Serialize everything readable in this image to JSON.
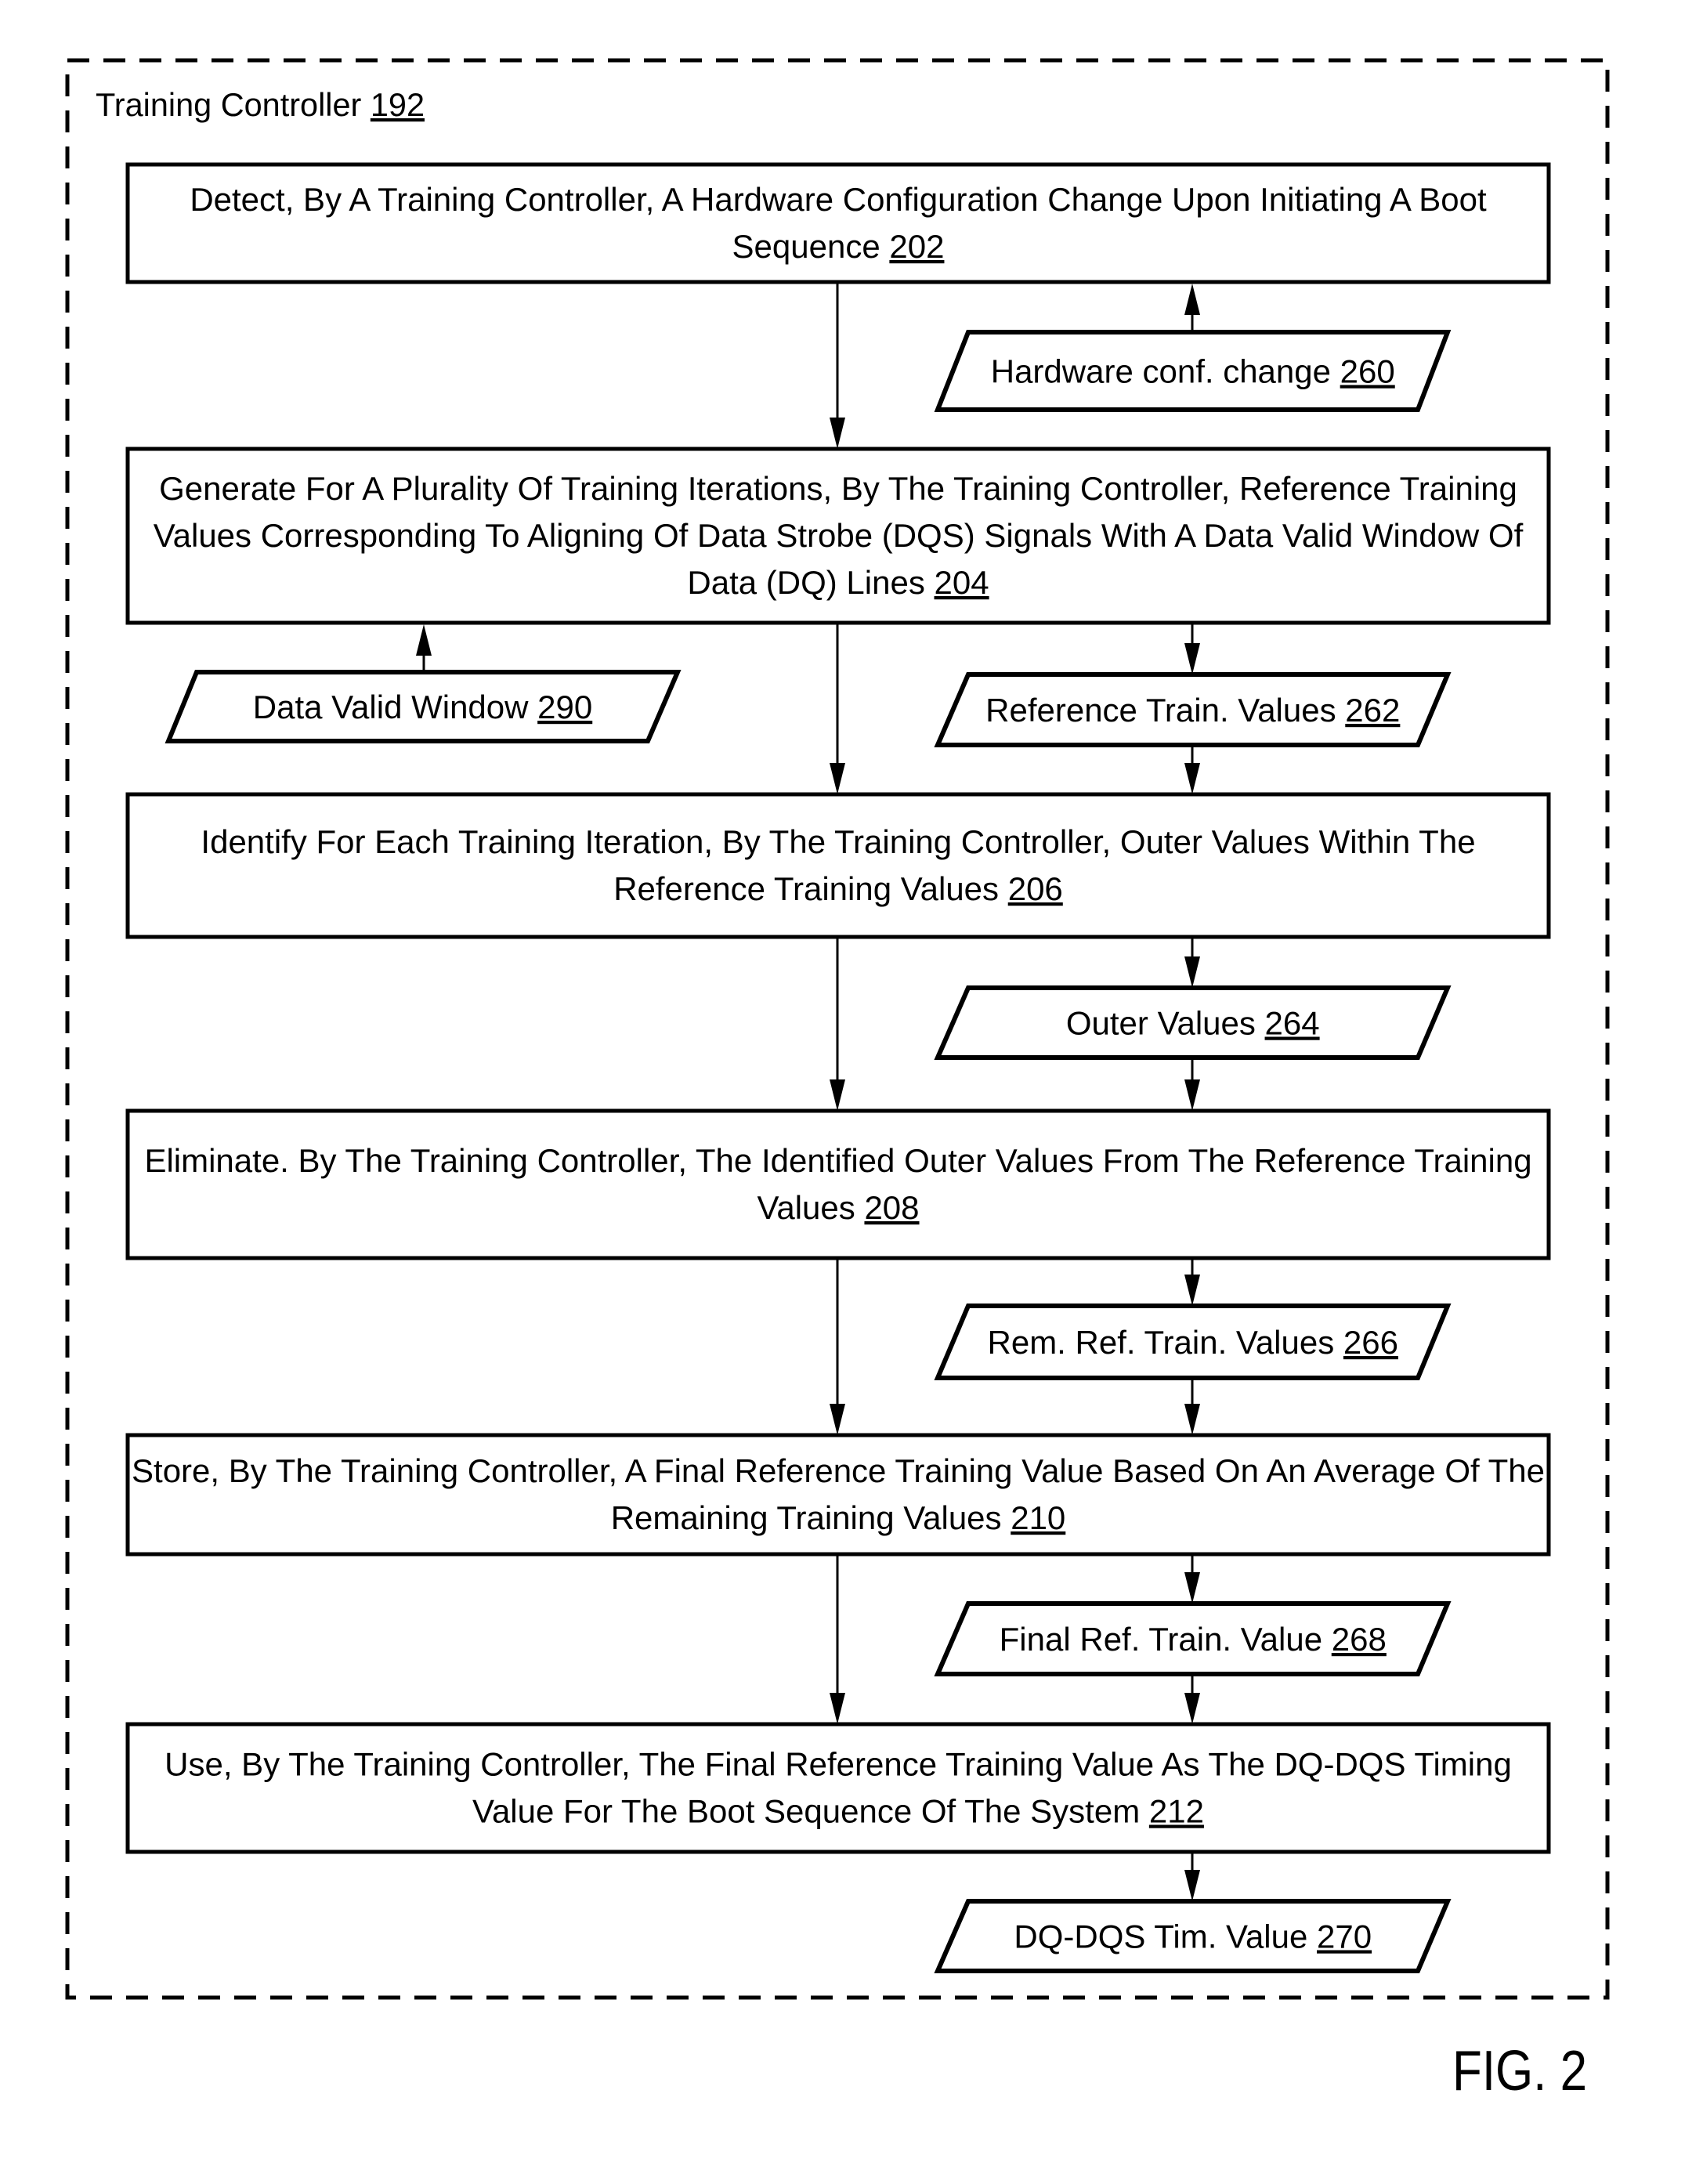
{
  "container": {
    "label": "Training Controller",
    "ref": "192"
  },
  "steps": [
    {
      "id": "202",
      "lines": [
        "Detect, By A Training Controller, A Hardware Configuration Change Upon Initiating A Boot",
        "Sequence"
      ],
      "ref": "202"
    },
    {
      "id": "204",
      "lines": [
        "Generate For A Plurality Of Training Iterations, By The Training Controller, Reference Training",
        "Values Corresponding To Aligning Of Data Strobe (DQS) Signals With A Data Valid Window Of",
        "Data (DQ) Lines"
      ],
      "ref": "204"
    },
    {
      "id": "206",
      "lines": [
        "Identify For Each Training Iteration, By The Training Controller, Outer Values Within The",
        "Reference Training Values"
      ],
      "ref": "206"
    },
    {
      "id": "208",
      "lines": [
        "Eliminate. By The Training Controller, The Identified Outer Values From The Reference Training",
        "Values"
      ],
      "ref": "208"
    },
    {
      "id": "210",
      "lines": [
        "Store, By The Training Controller, A Final Reference Training Value Based On An Average Of The",
        "Remaining Training Values"
      ],
      "ref": "210"
    },
    {
      "id": "212",
      "lines": [
        "Use, By The Training Controller, The Final Reference Training Value As The DQ-DQS Timing",
        "Value For The Boot Sequence Of The System"
      ],
      "ref": "212"
    }
  ],
  "data_items": [
    {
      "id": "260",
      "label": "Hardware conf. change",
      "ref": "260"
    },
    {
      "id": "290",
      "label": "Data Valid Window",
      "ref": "290"
    },
    {
      "id": "262",
      "label": "Reference Train. Values",
      "ref": "262"
    },
    {
      "id": "264",
      "label": "Outer Values",
      "ref": "264"
    },
    {
      "id": "266",
      "label": "Rem. Ref. Train. Values",
      "ref": "266"
    },
    {
      "id": "268",
      "label": "Final Ref. Train. Value",
      "ref": "268"
    },
    {
      "id": "270",
      "label": "DQ-DQS Tim. Value",
      "ref": "270"
    }
  ],
  "figure_label": "FIG. 2"
}
